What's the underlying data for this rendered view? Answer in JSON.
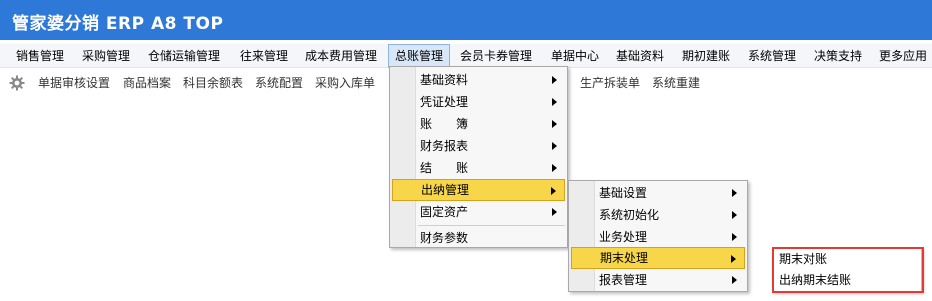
{
  "app": {
    "title": "管家婆分销 ERP A8 TOP"
  },
  "menubar": {
    "items": [
      {
        "label": "销售管理"
      },
      {
        "label": "采购管理"
      },
      {
        "label": "仓储运输管理"
      },
      {
        "label": "往来管理"
      },
      {
        "label": "成本费用管理"
      },
      {
        "label": "总账管理"
      },
      {
        "label": "会员卡券管理"
      },
      {
        "label": "单据中心"
      },
      {
        "label": "基础资料"
      },
      {
        "label": "期初建账"
      },
      {
        "label": "系统管理"
      },
      {
        "label": "决策支持"
      },
      {
        "label": "更多应用"
      }
    ],
    "active": "总账管理"
  },
  "toolbar": {
    "gear_icon": "gear-icon",
    "items": [
      {
        "label": "单据审核设置"
      },
      {
        "label": "商品档案"
      },
      {
        "label": "科目余额表"
      },
      {
        "label": "系统配置"
      },
      {
        "label": "采购入库单"
      },
      {
        "label": "生产拆装单"
      },
      {
        "label": "系统重建"
      }
    ]
  },
  "menu_level1": {
    "items": [
      {
        "label": "基础资料",
        "submenu": true
      },
      {
        "label": "凭证处理",
        "submenu": true
      },
      {
        "label": "账　　簿",
        "submenu": true
      },
      {
        "label": "财务报表",
        "submenu": true
      },
      {
        "label": "结　　账",
        "submenu": true
      },
      {
        "label": "出纳管理",
        "submenu": true
      },
      {
        "label": "固定资产",
        "submenu": true
      },
      {
        "label": "财务参数",
        "submenu": false
      }
    ],
    "selected": "出纳管理"
  },
  "menu_level2": {
    "items": [
      {
        "label": "基础设置",
        "submenu": true
      },
      {
        "label": "系统初始化",
        "submenu": true
      },
      {
        "label": "业务处理",
        "submenu": true
      },
      {
        "label": "期末处理",
        "submenu": true
      },
      {
        "label": "报表管理",
        "submenu": true
      }
    ],
    "selected": "期末处理"
  },
  "menu_level3": {
    "items": [
      {
        "label": "期末对账"
      },
      {
        "label": "出纳期末结账"
      }
    ]
  },
  "colors": {
    "titlebar": "#2e78d8",
    "menu_highlight": "#f7d64a",
    "annotation_box": "#e53935"
  }
}
